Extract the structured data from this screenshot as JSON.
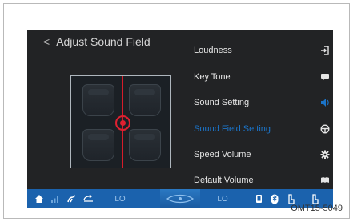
{
  "header": {
    "title": "Adjust Sound Field",
    "back_glyph": "<"
  },
  "menu": {
    "items": [
      {
        "label": "Loudness",
        "icon": "enter-arrow-icon",
        "active": false
      },
      {
        "label": "Key Tone",
        "icon": "speech-bubble-icon",
        "active": false
      },
      {
        "label": "Sound Setting",
        "icon": "speaker-icon",
        "active": false
      },
      {
        "label": "Sound Field Setting",
        "icon": "steering-wheel-icon",
        "active": true
      },
      {
        "label": "Speed Volume",
        "icon": "gear-icon",
        "active": false
      },
      {
        "label": "Default Volume",
        "icon": "book-icon",
        "active": false
      }
    ]
  },
  "statusbar": {
    "left_temp": "LO",
    "right_temp": "LO",
    "icons": [
      "home-icon",
      "signal-icon",
      "fan-icon",
      "recirculation-icon",
      "climate-center-icon",
      "phone-icon",
      "bluetooth-icon",
      "seat-heat-left-icon",
      "seat-heat-right-icon"
    ]
  },
  "caption": "OMT15-5049",
  "colors": {
    "screen_bg": "#222325",
    "status_bar": "#1b62ad",
    "active_item": "#1b74c9",
    "crosshair": "#d61c2a"
  }
}
